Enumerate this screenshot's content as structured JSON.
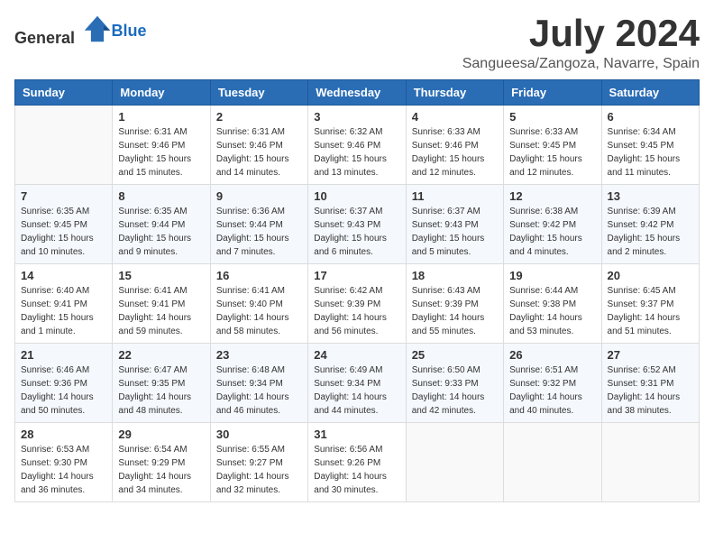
{
  "logo": {
    "general": "General",
    "blue": "Blue"
  },
  "title": {
    "month_year": "July 2024",
    "location": "Sangueesa/Zangoza, Navarre, Spain"
  },
  "headers": [
    "Sunday",
    "Monday",
    "Tuesday",
    "Wednesday",
    "Thursday",
    "Friday",
    "Saturday"
  ],
  "weeks": [
    [
      {
        "day": "",
        "content": ""
      },
      {
        "day": "1",
        "content": "Sunrise: 6:31 AM\nSunset: 9:46 PM\nDaylight: 15 hours\nand 15 minutes."
      },
      {
        "day": "2",
        "content": "Sunrise: 6:31 AM\nSunset: 9:46 PM\nDaylight: 15 hours\nand 14 minutes."
      },
      {
        "day": "3",
        "content": "Sunrise: 6:32 AM\nSunset: 9:46 PM\nDaylight: 15 hours\nand 13 minutes."
      },
      {
        "day": "4",
        "content": "Sunrise: 6:33 AM\nSunset: 9:46 PM\nDaylight: 15 hours\nand 12 minutes."
      },
      {
        "day": "5",
        "content": "Sunrise: 6:33 AM\nSunset: 9:45 PM\nDaylight: 15 hours\nand 12 minutes."
      },
      {
        "day": "6",
        "content": "Sunrise: 6:34 AM\nSunset: 9:45 PM\nDaylight: 15 hours\nand 11 minutes."
      }
    ],
    [
      {
        "day": "7",
        "content": "Sunrise: 6:35 AM\nSunset: 9:45 PM\nDaylight: 15 hours\nand 10 minutes."
      },
      {
        "day": "8",
        "content": "Sunrise: 6:35 AM\nSunset: 9:44 PM\nDaylight: 15 hours\nand 9 minutes."
      },
      {
        "day": "9",
        "content": "Sunrise: 6:36 AM\nSunset: 9:44 PM\nDaylight: 15 hours\nand 7 minutes."
      },
      {
        "day": "10",
        "content": "Sunrise: 6:37 AM\nSunset: 9:43 PM\nDaylight: 15 hours\nand 6 minutes."
      },
      {
        "day": "11",
        "content": "Sunrise: 6:37 AM\nSunset: 9:43 PM\nDaylight: 15 hours\nand 5 minutes."
      },
      {
        "day": "12",
        "content": "Sunrise: 6:38 AM\nSunset: 9:42 PM\nDaylight: 15 hours\nand 4 minutes."
      },
      {
        "day": "13",
        "content": "Sunrise: 6:39 AM\nSunset: 9:42 PM\nDaylight: 15 hours\nand 2 minutes."
      }
    ],
    [
      {
        "day": "14",
        "content": "Sunrise: 6:40 AM\nSunset: 9:41 PM\nDaylight: 15 hours\nand 1 minute."
      },
      {
        "day": "15",
        "content": "Sunrise: 6:41 AM\nSunset: 9:41 PM\nDaylight: 14 hours\nand 59 minutes."
      },
      {
        "day": "16",
        "content": "Sunrise: 6:41 AM\nSunset: 9:40 PM\nDaylight: 14 hours\nand 58 minutes."
      },
      {
        "day": "17",
        "content": "Sunrise: 6:42 AM\nSunset: 9:39 PM\nDaylight: 14 hours\nand 56 minutes."
      },
      {
        "day": "18",
        "content": "Sunrise: 6:43 AM\nSunset: 9:39 PM\nDaylight: 14 hours\nand 55 minutes."
      },
      {
        "day": "19",
        "content": "Sunrise: 6:44 AM\nSunset: 9:38 PM\nDaylight: 14 hours\nand 53 minutes."
      },
      {
        "day": "20",
        "content": "Sunrise: 6:45 AM\nSunset: 9:37 PM\nDaylight: 14 hours\nand 51 minutes."
      }
    ],
    [
      {
        "day": "21",
        "content": "Sunrise: 6:46 AM\nSunset: 9:36 PM\nDaylight: 14 hours\nand 50 minutes."
      },
      {
        "day": "22",
        "content": "Sunrise: 6:47 AM\nSunset: 9:35 PM\nDaylight: 14 hours\nand 48 minutes."
      },
      {
        "day": "23",
        "content": "Sunrise: 6:48 AM\nSunset: 9:34 PM\nDaylight: 14 hours\nand 46 minutes."
      },
      {
        "day": "24",
        "content": "Sunrise: 6:49 AM\nSunset: 9:34 PM\nDaylight: 14 hours\nand 44 minutes."
      },
      {
        "day": "25",
        "content": "Sunrise: 6:50 AM\nSunset: 9:33 PM\nDaylight: 14 hours\nand 42 minutes."
      },
      {
        "day": "26",
        "content": "Sunrise: 6:51 AM\nSunset: 9:32 PM\nDaylight: 14 hours\nand 40 minutes."
      },
      {
        "day": "27",
        "content": "Sunrise: 6:52 AM\nSunset: 9:31 PM\nDaylight: 14 hours\nand 38 minutes."
      }
    ],
    [
      {
        "day": "28",
        "content": "Sunrise: 6:53 AM\nSunset: 9:30 PM\nDaylight: 14 hours\nand 36 minutes."
      },
      {
        "day": "29",
        "content": "Sunrise: 6:54 AM\nSunset: 9:29 PM\nDaylight: 14 hours\nand 34 minutes."
      },
      {
        "day": "30",
        "content": "Sunrise: 6:55 AM\nSunset: 9:27 PM\nDaylight: 14 hours\nand 32 minutes."
      },
      {
        "day": "31",
        "content": "Sunrise: 6:56 AM\nSunset: 9:26 PM\nDaylight: 14 hours\nand 30 minutes."
      },
      {
        "day": "",
        "content": ""
      },
      {
        "day": "",
        "content": ""
      },
      {
        "day": "",
        "content": ""
      }
    ]
  ]
}
